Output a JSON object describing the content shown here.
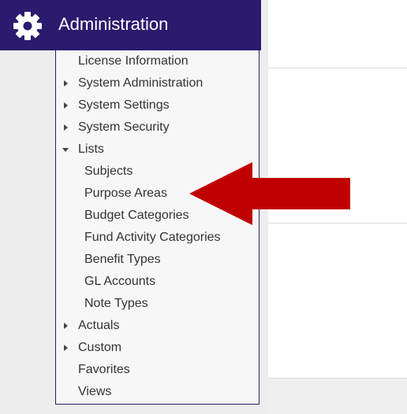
{
  "header": {
    "title": "Administration",
    "icon": "gear-icon",
    "background": "#2c1a6e"
  },
  "menu": {
    "items": [
      {
        "label": "License Information",
        "expandable": false
      },
      {
        "label": "System Administration",
        "expandable": true,
        "expanded": false
      },
      {
        "label": "System Settings",
        "expandable": true,
        "expanded": false
      },
      {
        "label": "System Security",
        "expandable": true,
        "expanded": false
      },
      {
        "label": "Lists",
        "expandable": true,
        "expanded": true,
        "children": [
          {
            "label": "Subjects"
          },
          {
            "label": "Purpose Areas"
          },
          {
            "label": "Budget Categories"
          },
          {
            "label": "Fund Activity Categories"
          },
          {
            "label": "Benefit Types"
          },
          {
            "label": "GL Accounts"
          },
          {
            "label": "Note Types"
          }
        ]
      },
      {
        "label": "Actuals",
        "expandable": true,
        "expanded": false
      },
      {
        "label": "Custom",
        "expandable": true,
        "expanded": false
      },
      {
        "label": "Favorites",
        "expandable": false
      },
      {
        "label": "Views",
        "expandable": false
      }
    ]
  },
  "annotation": {
    "type": "arrow",
    "color": "#c00000",
    "points_to": "Purpose Areas"
  }
}
